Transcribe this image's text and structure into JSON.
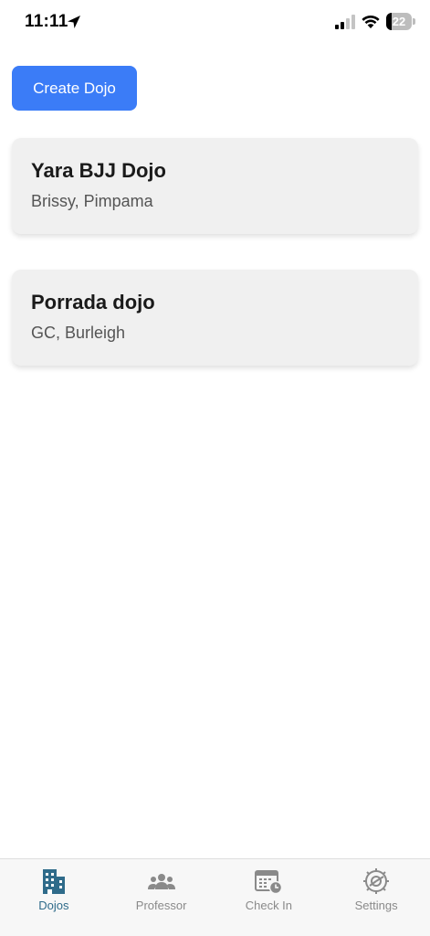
{
  "status_bar": {
    "time": "11:11",
    "battery_level": "22",
    "battery_fraction": 0.22
  },
  "toolbar": {
    "create_label": "Create Dojo"
  },
  "dojos": [
    {
      "name": "Yara BJJ Dojo",
      "location": "Brissy, Pimpama"
    },
    {
      "name": "Porrada dojo",
      "location": "GC, Burleigh"
    }
  ],
  "tabs": [
    {
      "label": "Dojos",
      "icon": "building-icon",
      "active": true
    },
    {
      "label": "Professor",
      "icon": "people-icon",
      "active": false
    },
    {
      "label": "Check In",
      "icon": "calendar-clock-icon",
      "active": false
    },
    {
      "label": "Settings",
      "icon": "gear-icon",
      "active": false
    }
  ],
  "colors": {
    "accent": "#3b7cf7",
    "active_tab": "#2f6b8a",
    "inactive_tab": "#8a8a8a",
    "card_bg": "#f0f0f0"
  }
}
